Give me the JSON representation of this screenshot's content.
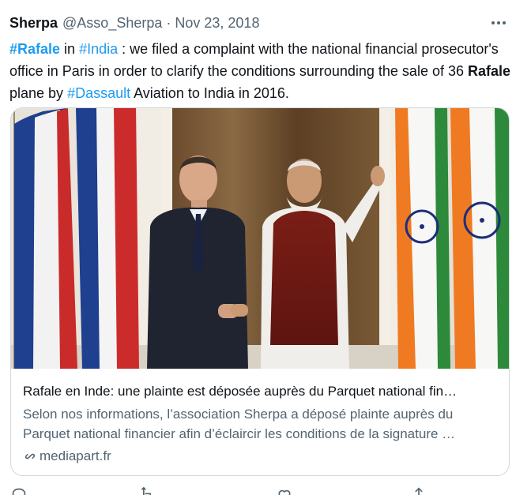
{
  "tweet": {
    "author_name": "Sherpa",
    "handle": "@Asso_Sherpa",
    "separator": "·",
    "date": "Nov 23, 2018",
    "more_icon": "ellipsis-icon",
    "text": {
      "hashtag_rafale": "#Rafale",
      "part1": " in ",
      "hashtag_india": "#India",
      "part2": " : we filed a complaint with the national financial prosecutor's office in Paris in order to clarify the conditions surrounding the sale of 36 ",
      "bold_rafale": "Rafale",
      "part3": " plane by ",
      "hashtag_dassault": "#Dassault",
      "part4": " Aviation to India in 2016."
    }
  },
  "card": {
    "image_icon": "link-preview-photo",
    "title": "Rafale en Inde: une plainte est déposée auprès du Parquet national fin…",
    "description": "Selon nos informations, l’association Sherpa a déposé plainte auprès du Parquet national financier afin d’éclaircir les conditions de la signature …",
    "domain_icon": "link-icon",
    "domain": "mediapart.fr"
  },
  "actions": [
    {
      "icon": "reply-icon"
    },
    {
      "icon": "retweet-icon"
    },
    {
      "icon": "like-icon"
    },
    {
      "icon": "share-icon"
    }
  ],
  "colors": {
    "accent": "#1d9bf0",
    "text_primary": "#0f1419",
    "text_secondary": "#536471",
    "border": "#cfd9de"
  }
}
